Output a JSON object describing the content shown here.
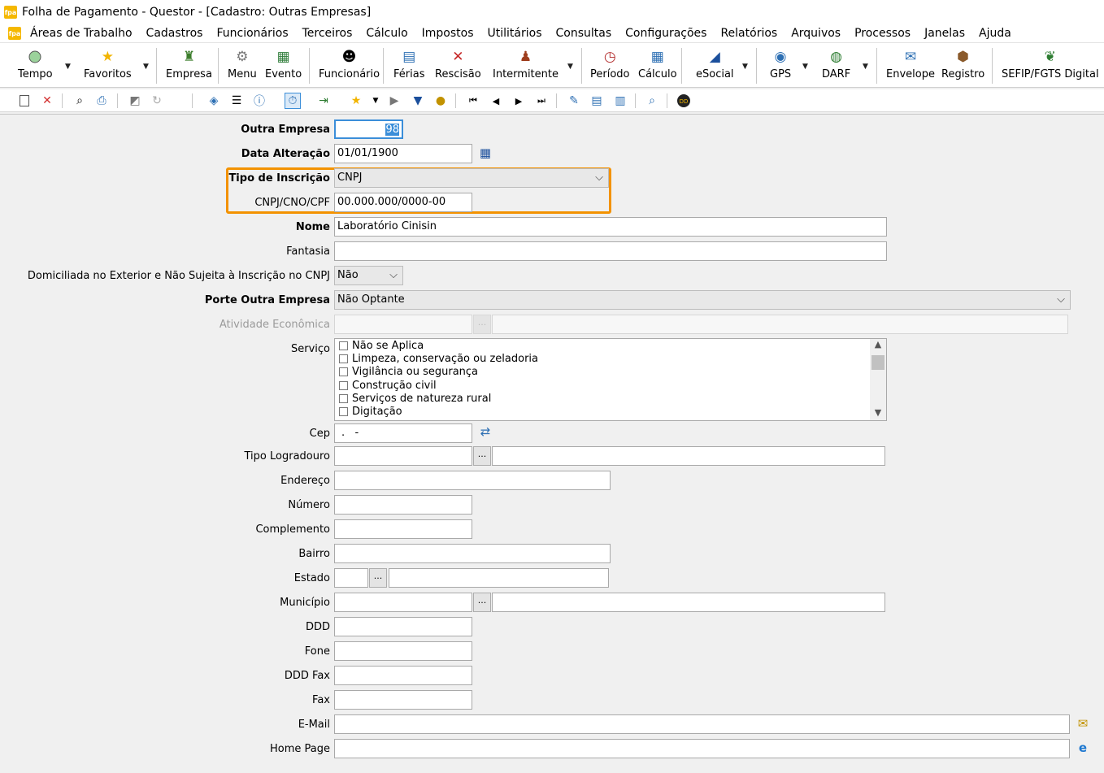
{
  "window": {
    "app_icon": "fpa",
    "title": "Folha de Pagamento - Questor - [Cadastro: Outras Empresas]"
  },
  "menu": [
    "Áreas de Trabalho",
    "Cadastros",
    "Funcionários",
    "Terceiros",
    "Cálculo",
    "Impostos",
    "Utilitários",
    "Consultas",
    "Configurações",
    "Relatórios",
    "Arquivos",
    "Processos",
    "Janelas",
    "Ajuda"
  ],
  "toolbar": {
    "tempo": "Tempo",
    "favoritos": "Favoritos",
    "empresa": "Empresa",
    "menu": "Menu",
    "evento": "Evento",
    "funcionario": "Funcionário",
    "ferias": "Férias",
    "rescisao": "Rescisão",
    "intermitente": "Intermitente",
    "periodo": "Período",
    "calculo": "Cálculo",
    "esocial": "eSocial",
    "gps": "GPS",
    "darf": "DARF",
    "envelope": "Envelope",
    "registro": "Registro",
    "sefip": "SEFIP/FGTS Digital"
  },
  "form": {
    "outra_empresa": {
      "label": "Outra Empresa",
      "value": "98"
    },
    "data_alteracao": {
      "label": "Data Alteração",
      "value": "01/01/1900"
    },
    "tipo_inscricao": {
      "label": "Tipo de Inscrição",
      "value": "CNPJ"
    },
    "cnpj": {
      "label": "CNPJ/CNO/CPF",
      "value": "00.000.000/0000-00"
    },
    "nome": {
      "label": "Nome",
      "value": "Laboratório Cinisin"
    },
    "fantasia": {
      "label": "Fantasia",
      "value": ""
    },
    "domiciliada": {
      "label": "Domiciliada no Exterior e Não Sujeita à Inscrição no CNPJ",
      "value": "Não"
    },
    "porte": {
      "label": "Porte Outra Empresa",
      "value": "Não Optante"
    },
    "atividade": {
      "label": "Atividade Econômica",
      "value": ""
    },
    "servico": {
      "label": "Serviço",
      "options": [
        "Não se Aplica",
        "Limpeza, conservação ou zeladoria",
        "Vigilância ou segurança",
        "Construção civil",
        "Serviços de natureza rural",
        "Digitação"
      ]
    },
    "cep": {
      "label": "Cep",
      "value": ".   -"
    },
    "tipo_logradouro": {
      "label": "Tipo Logradouro",
      "value": ""
    },
    "endereco": {
      "label": "Endereço",
      "value": ""
    },
    "numero": {
      "label": "Número",
      "value": ""
    },
    "complemento": {
      "label": "Complemento",
      "value": ""
    },
    "bairro": {
      "label": "Bairro",
      "value": ""
    },
    "estado": {
      "label": "Estado",
      "value": ""
    },
    "municipio": {
      "label": "Município",
      "value": ""
    },
    "ddd": {
      "label": "DDD",
      "value": ""
    },
    "fone": {
      "label": "Fone",
      "value": ""
    },
    "ddd_fax": {
      "label": "DDD Fax",
      "value": ""
    },
    "fax": {
      "label": "Fax",
      "value": ""
    },
    "email": {
      "label": "E-Mail",
      "value": ""
    },
    "homepage": {
      "label": "Home Page",
      "value": ""
    }
  },
  "ui": {
    "lookup": "...",
    "chevron": "⌵"
  },
  "colors": {
    "highlight": "#f39200",
    "app_icon": "#f5b800",
    "focus": "#3b8ed9"
  }
}
